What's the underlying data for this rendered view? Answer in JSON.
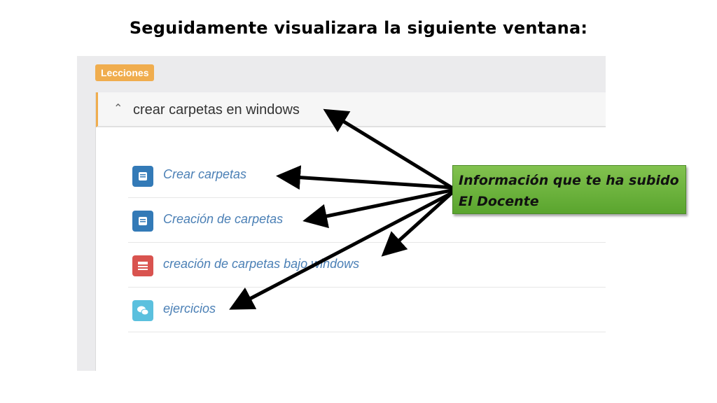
{
  "slide": {
    "title": "Seguidamente visualizara la siguiente ventana:"
  },
  "badge": {
    "label": "Lecciones",
    "color": "#f0ad4e"
  },
  "panel": {
    "title": "crear carpetas en windows",
    "chevron": "chevron-up-icon"
  },
  "items": [
    {
      "label": "Crear carpetas",
      "icon": "book-icon",
      "icon_color": "#337ab7"
    },
    {
      "label": "Creación de carpetas",
      "icon": "book-icon",
      "icon_color": "#337ab7"
    },
    {
      "label": "creación de carpetas bajo windows",
      "icon": "presentation-icon",
      "icon_color": "#d9534f"
    },
    {
      "label": "ejercicios",
      "icon": "chat-bubbles-icon",
      "icon_color": "#5bc0de"
    }
  ],
  "callout": {
    "line1": "Información que te ha subido",
    "line2": "El Docente",
    "color": "#6ab43a"
  }
}
